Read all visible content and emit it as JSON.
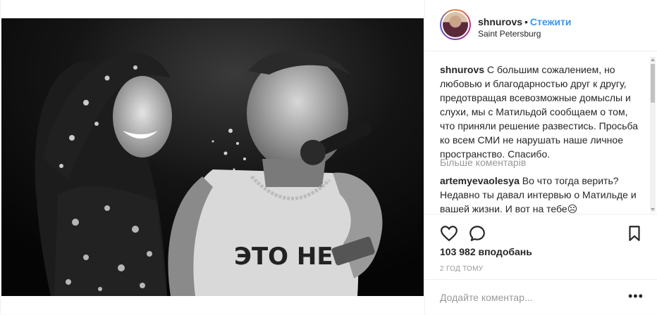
{
  "post": {
    "username": "shnurovs",
    "follow_label": "Стежити",
    "separator": "•",
    "location": "Saint Petersburg",
    "caption_user": "shnurovs",
    "caption_text": "С большим сожалением, но любовью и благодарностью друг к другу, предотвращая всевозможные домыслы и слухи, мы с Матильдой сообщаем о том, что приняли решение развестись. Просьба ко всем СМИ не нарушать наше личное пространство. Спасибо.",
    "more_comments_label": "Більше коментарів",
    "comment_user": "artemyevaolesya",
    "comment_text": "Во что тогда верить? Недавно ты давал интервью о Матильде и вашей жизни. И вот на тебе☹",
    "likes": "103 982 вподобань",
    "time_ago": "2 ГОД ТОМУ",
    "add_comment_placeholder": "Додайте коментар...",
    "more_dots": "•••",
    "photo_shirt_text": "ЭТО НЕ"
  },
  "icons": [
    "heart-icon",
    "comment-icon",
    "bookmark-icon",
    "more-options-icon"
  ],
  "colors": {
    "follow": "#3897f0",
    "text": "#262626",
    "muted": "#999999",
    "border": "#efefef"
  }
}
